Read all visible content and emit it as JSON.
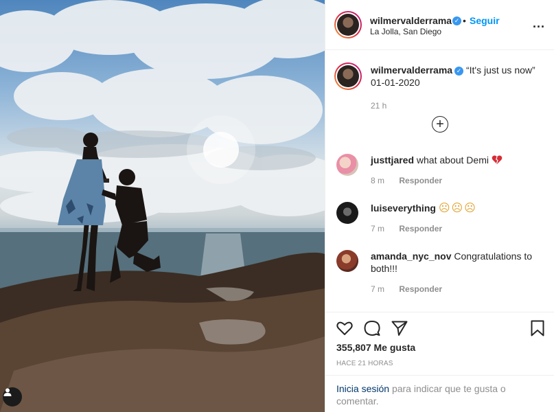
{
  "header": {
    "username": "wilmervalderrama",
    "separator": "•",
    "follow_label": "Seguir",
    "location": "La Jolla, San Diego",
    "more_label": "..."
  },
  "caption": {
    "username": "wilmervalderrama",
    "text": "“It's just us now” 01-01-2020",
    "time": "21 h"
  },
  "comments": [
    {
      "username": "justtjared",
      "text": "what about Demi",
      "emoji": "broken-heart",
      "time": "8 m",
      "reply_label": "Responder"
    },
    {
      "username": "luiseverything",
      "text": "☹☹☹",
      "time": "7 m",
      "reply_label": "Responder"
    },
    {
      "username": "amanda_nyc_nov",
      "text": "Congratulations to both!!!",
      "time": "7 m",
      "reply_label": "Responder"
    }
  ],
  "load_more_label": "+",
  "likes_text": "355,807 Me gusta",
  "time_ago": "HACE 21 HORAS",
  "login": {
    "link_text": "Inicia sesión",
    "rest_text": "para indicar que te gusta o comentar."
  },
  "icons": {
    "like": "heart-icon",
    "comment": "comment-icon",
    "share": "share-icon",
    "save": "bookmark-icon",
    "tag": "user-tag-icon"
  },
  "colors": {
    "accent": "#0095f6",
    "verified": "#3897f0",
    "muted": "#8e8e8e",
    "heart": "#d62d36"
  }
}
